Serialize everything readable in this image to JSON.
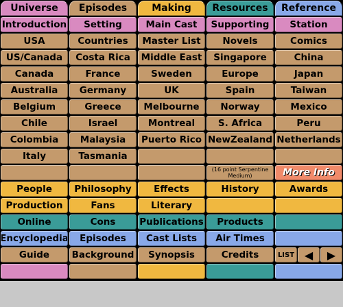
{
  "colors": {
    "pink": "#d98ac0",
    "brown": "#c49a6c",
    "orange": "#f0b840",
    "teal": "#3a9c98",
    "blue": "#88a8e8",
    "salmon": "#f08a6a",
    "background": "#c8c8c8",
    "grid_lines": "#000000"
  },
  "tabs": [
    "Universe",
    "Episodes",
    "Making",
    "Resources",
    "Reference"
  ],
  "rows": [
    [
      "Introduction",
      "Setting",
      "Main Cast",
      "Supporting",
      "Station"
    ],
    [
      "USA",
      "Countries",
      "Master List",
      "Novels",
      "Comics"
    ],
    [
      "US/Canada",
      "Costa Rica",
      "Middle East",
      "Singapore",
      "China"
    ],
    [
      "Canada",
      "France",
      "Sweden",
      "Europe",
      "Japan"
    ],
    [
      "Australia",
      "Germany",
      "UK",
      "Spain",
      "Taiwan"
    ],
    [
      "Belgium",
      "Greece",
      "Melbourne",
      "Norway",
      "Mexico"
    ],
    [
      "Chile",
      "Israel",
      "Montreal",
      "S. Africa",
      "Peru"
    ],
    [
      "Colombia",
      "Malaysia",
      "Puerto Rico",
      "NewZealand",
      "Netherlands"
    ],
    [
      "Italy",
      "Tasmania",
      "",
      "",
      ""
    ],
    [
      "",
      "",
      "",
      "(16 point Serpentine Medium)",
      "More Info"
    ],
    [
      "People",
      "Philosophy",
      "Effects",
      "History",
      "Awards"
    ],
    [
      "Production",
      "Fans",
      "Literary",
      "",
      ""
    ],
    [
      "Online",
      "Cons",
      "Publications",
      "Products",
      ""
    ],
    [
      "Encyclopedia",
      "Episodes",
      "Cast Lists",
      "Air Times",
      ""
    ],
    [
      "Guide",
      "Background",
      "Synopsis",
      "Credits",
      ""
    ],
    [
      "",
      "",
      "",
      "",
      ""
    ]
  ],
  "nav": {
    "list_label": "LIST",
    "prev_icon": "left-arrow-icon",
    "next_icon": "right-arrow-icon",
    "prev_glyph": "◀",
    "next_glyph": "▶"
  }
}
